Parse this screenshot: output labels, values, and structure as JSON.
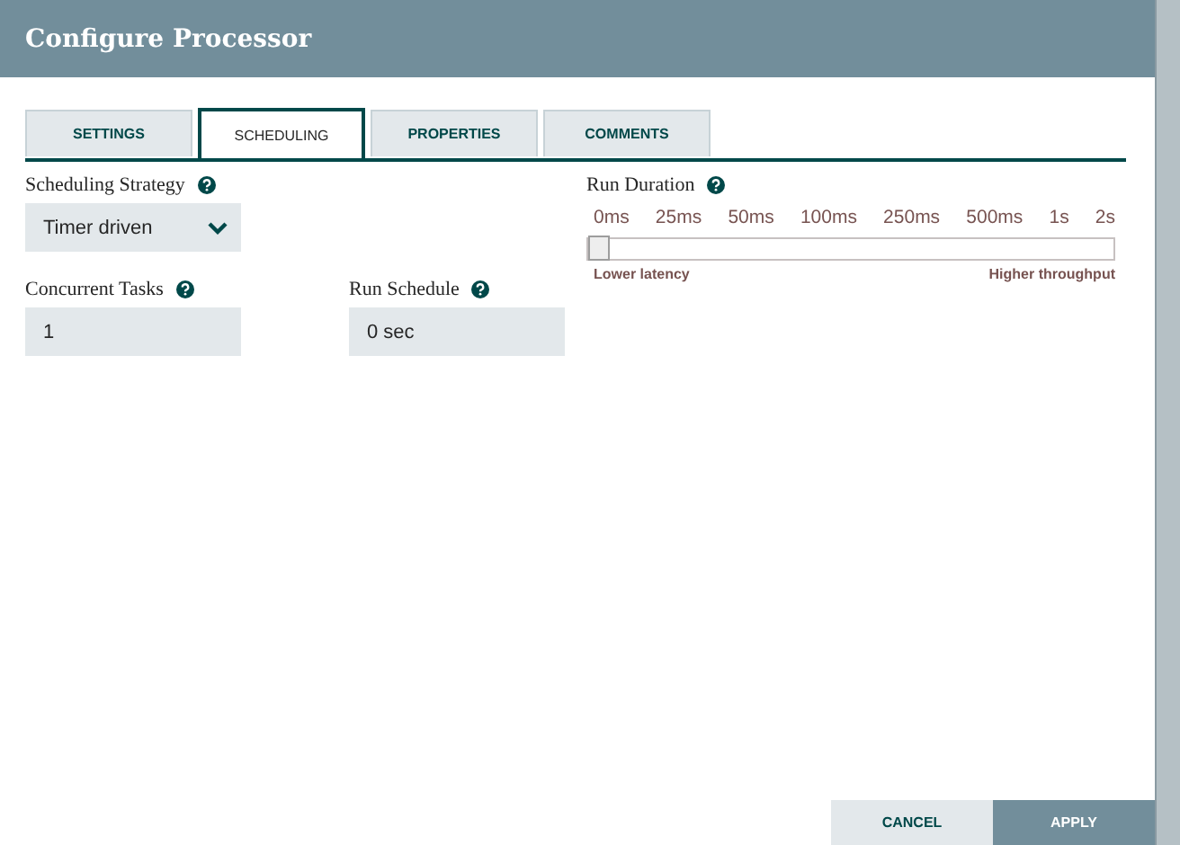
{
  "window": {
    "title": "Configure Processor"
  },
  "tabs": [
    {
      "label": "SETTINGS",
      "selected": false
    },
    {
      "label": "SCHEDULING",
      "selected": true
    },
    {
      "label": "PROPERTIES",
      "selected": false
    },
    {
      "label": "COMMENTS",
      "selected": false
    }
  ],
  "scheduling_strategy": {
    "label": "Scheduling Strategy",
    "value": "Timer driven"
  },
  "concurrent_tasks": {
    "label": "Concurrent Tasks",
    "value": "1"
  },
  "run_schedule": {
    "label": "Run Schedule",
    "value": "0 sec"
  },
  "run_duration": {
    "label": "Run Duration",
    "ticks": [
      "0ms",
      "25ms",
      "50ms",
      "100ms",
      "250ms",
      "500ms",
      "1s",
      "2s"
    ],
    "level": 0,
    "min_label": "Lower latency",
    "max_label": "Higher throughput"
  },
  "buttons": [
    {
      "label": "CANCEL",
      "kind": "secondary"
    },
    {
      "label": "APPLY",
      "kind": "primary"
    }
  ]
}
